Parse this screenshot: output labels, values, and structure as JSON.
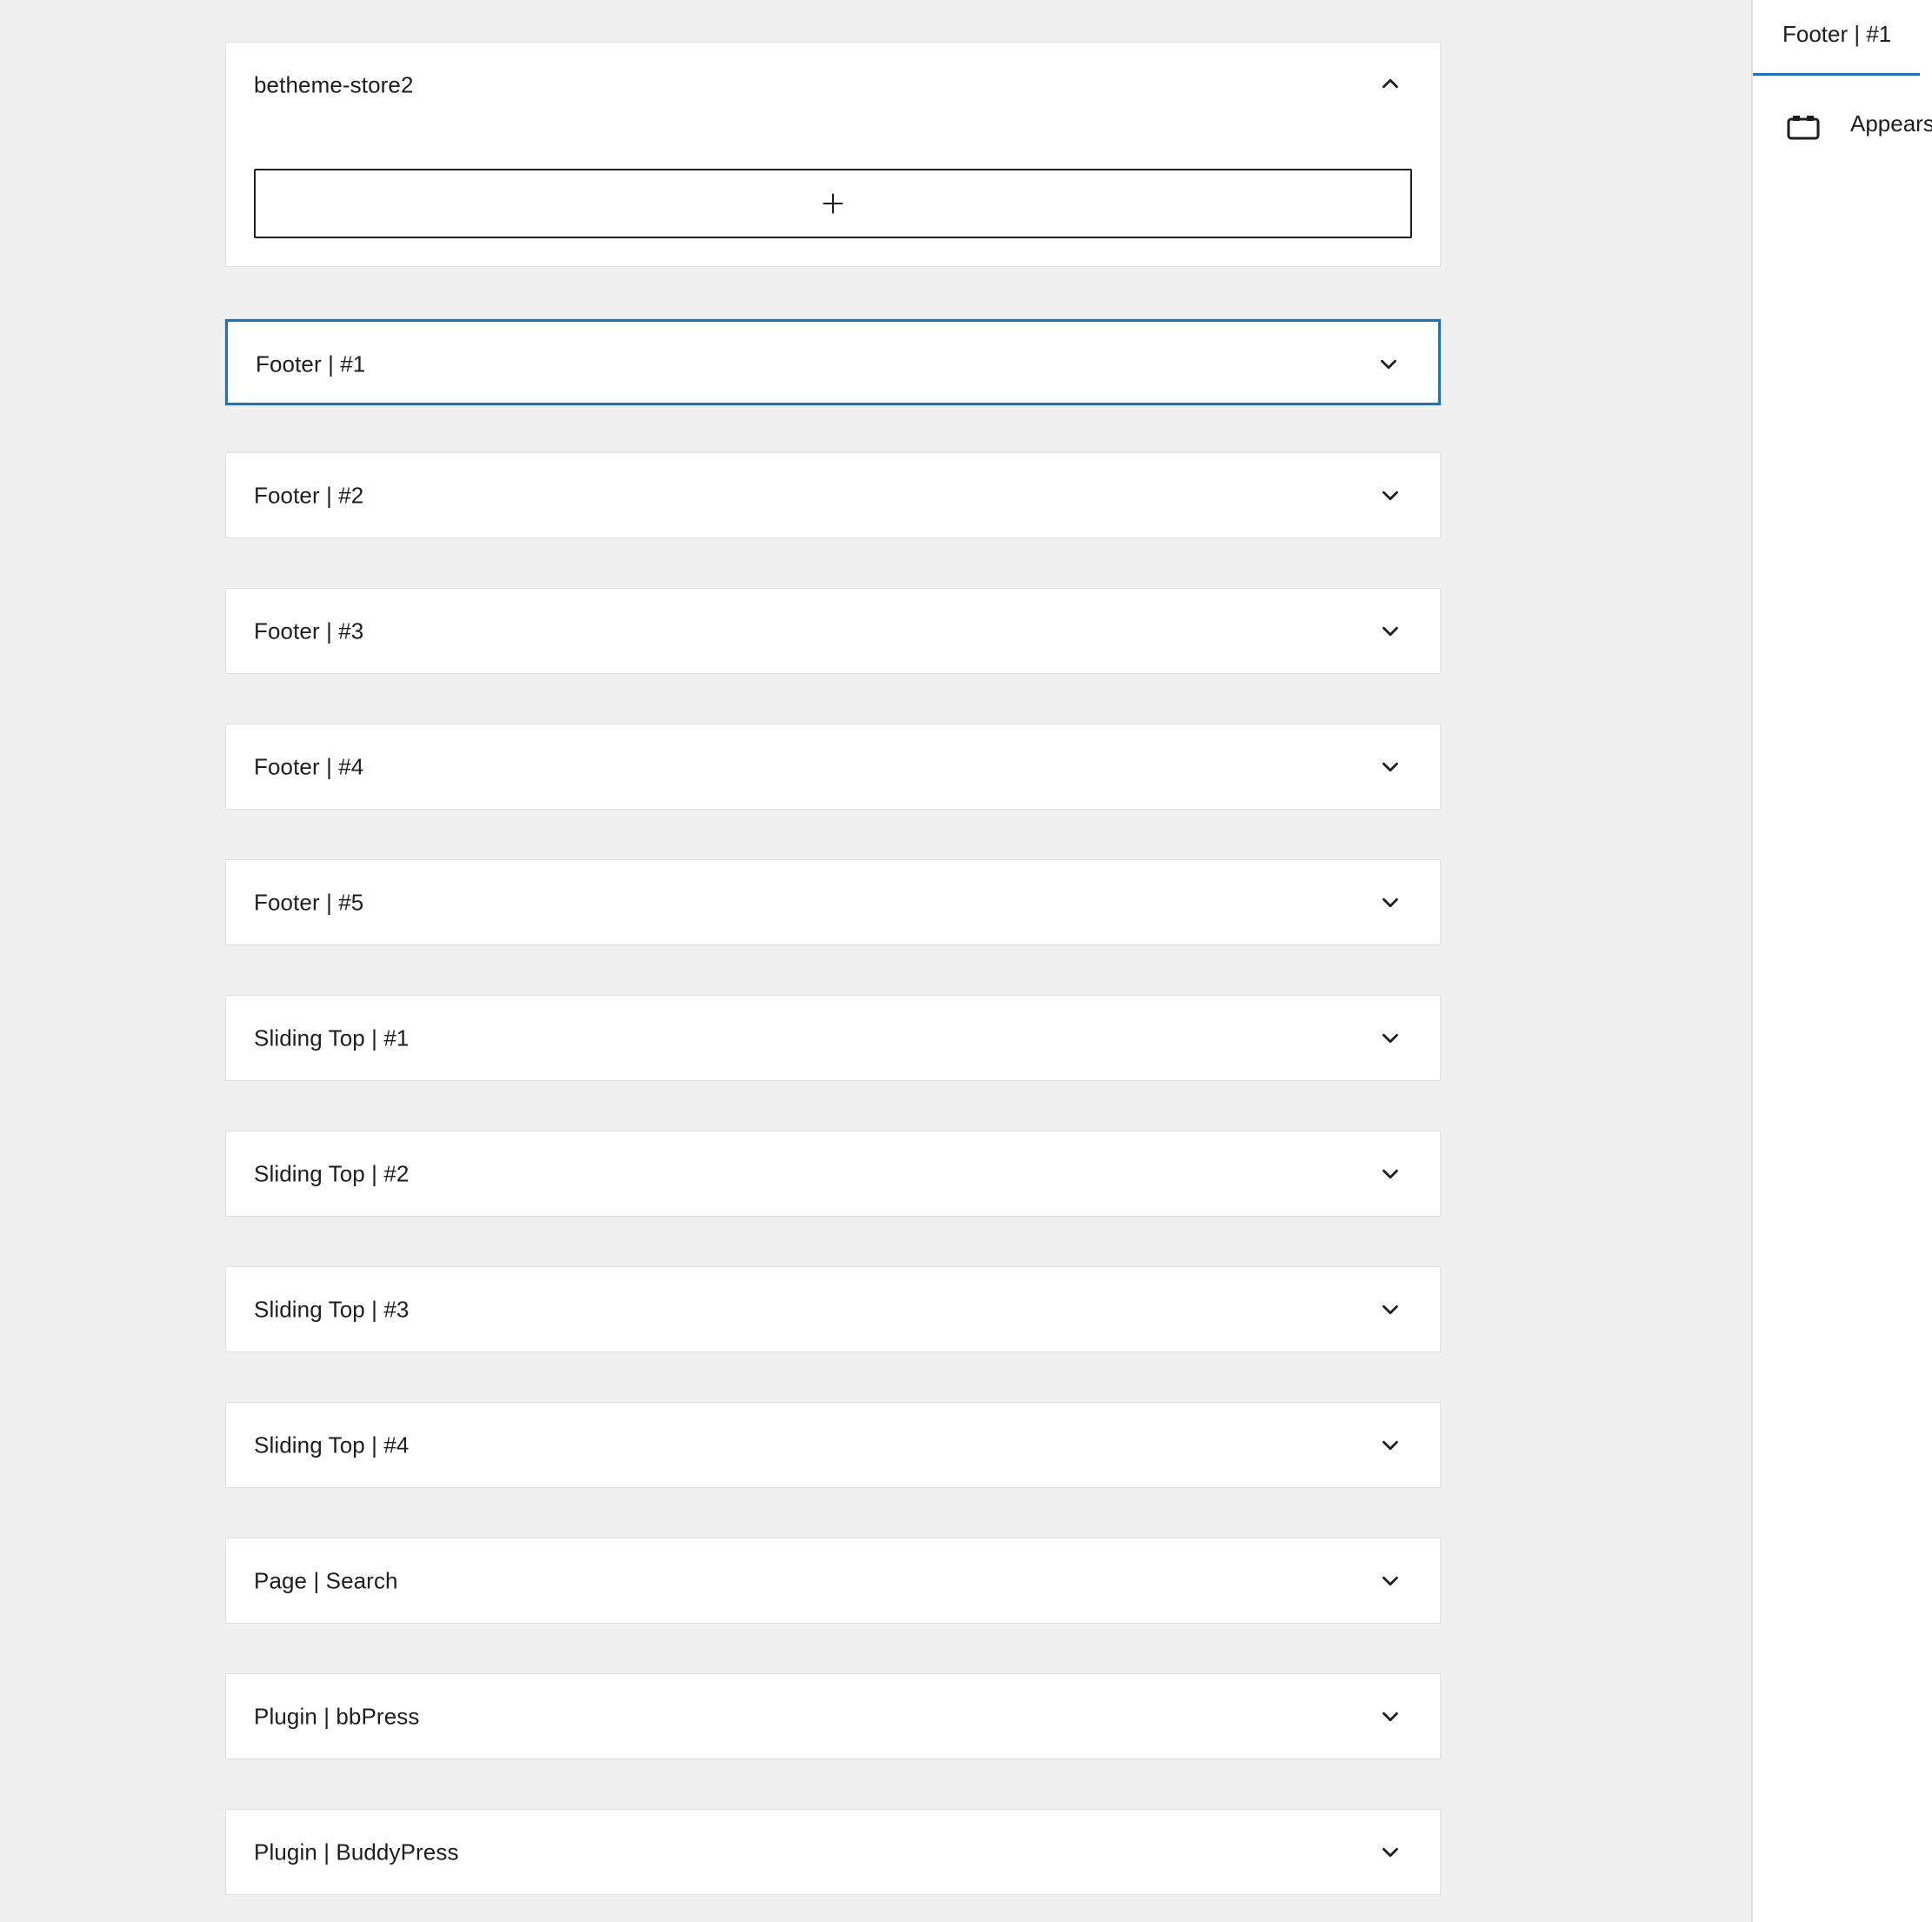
{
  "widget_areas": [
    {
      "title": "betheme-store2",
      "expanded": true
    },
    {
      "title": "Footer | #1",
      "expanded": false,
      "focused": true
    },
    {
      "title": "Footer | #2",
      "expanded": false
    },
    {
      "title": "Footer | #3",
      "expanded": false
    },
    {
      "title": "Footer | #4",
      "expanded": false
    },
    {
      "title": "Footer | #5",
      "expanded": false
    },
    {
      "title": "Sliding Top | #1",
      "expanded": false
    },
    {
      "title": "Sliding Top | #2",
      "expanded": false
    },
    {
      "title": "Sliding Top | #3",
      "expanded": false
    },
    {
      "title": "Sliding Top | #4",
      "expanded": false
    },
    {
      "title": "Page | Search",
      "expanded": false
    },
    {
      "title": "Plugin | bbPress",
      "expanded": false
    },
    {
      "title": "Plugin | BuddyPress",
      "expanded": false
    }
  ],
  "add_block": {
    "symbol": "+",
    "icon": "plus-icon"
  },
  "sidebar": {
    "tab_label": "Footer | #1",
    "icon": "widget-area-icon",
    "description": "Appears in the site."
  },
  "colors": {
    "accent": "#2271b1",
    "background": "#f0f0f0",
    "panel": "#ffffff",
    "border": "#e0e0e0",
    "text": "#1e1e1e"
  }
}
